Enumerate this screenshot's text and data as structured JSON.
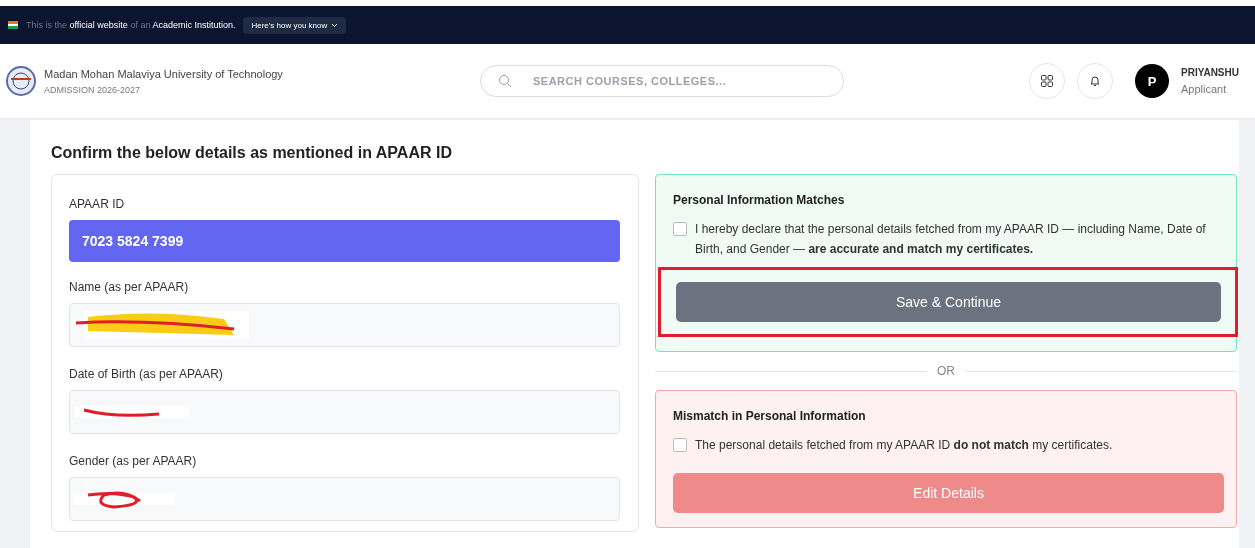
{
  "gov_banner": {
    "text": "This is the **official website** of an **Academic Institution.**",
    "button": "Here's how you know"
  },
  "header": {
    "university": "Madan Mohan Malaviya University of Technology",
    "subtitle": "ADMISSION 2026-2027",
    "search": {
      "placeholder": "SEARCH COURSES, COLLEGES..."
    },
    "user": {
      "initial": "P",
      "name": "PRIYANSHU",
      "role": "Applicant"
    }
  },
  "page": {
    "title": "Confirm the below details as mentioned in APAAR ID",
    "apaar": {
      "label": "APAAR ID",
      "value": "7023 5824 7399"
    },
    "fields": [
      {
        "label": "Name (as per APAAR)",
        "kind": "highlight"
      },
      {
        "label": "Date of Birth (as per APAAR)",
        "kind": "strike"
      },
      {
        "label": "Gender (as per APAAR)",
        "kind": "scribble"
      }
    ],
    "match": {
      "title": "Personal Information Matches",
      "checked": false,
      "text": "I hereby declare that the personal details fetched from my APAAR ID — including Name, Date of Birth, and Gender — **are accurate and match my certificates.**",
      "button": "Save & Continue",
      "disabled": true,
      "highlighted": true
    },
    "divider": "OR",
    "mismatch": {
      "title": "Mismatch in Personal Information",
      "checked": false,
      "text": "The personal details fetched from my APAAR ID **do not match** my certificates.",
      "button": "Edit Details",
      "disabled": true
    }
  }
}
